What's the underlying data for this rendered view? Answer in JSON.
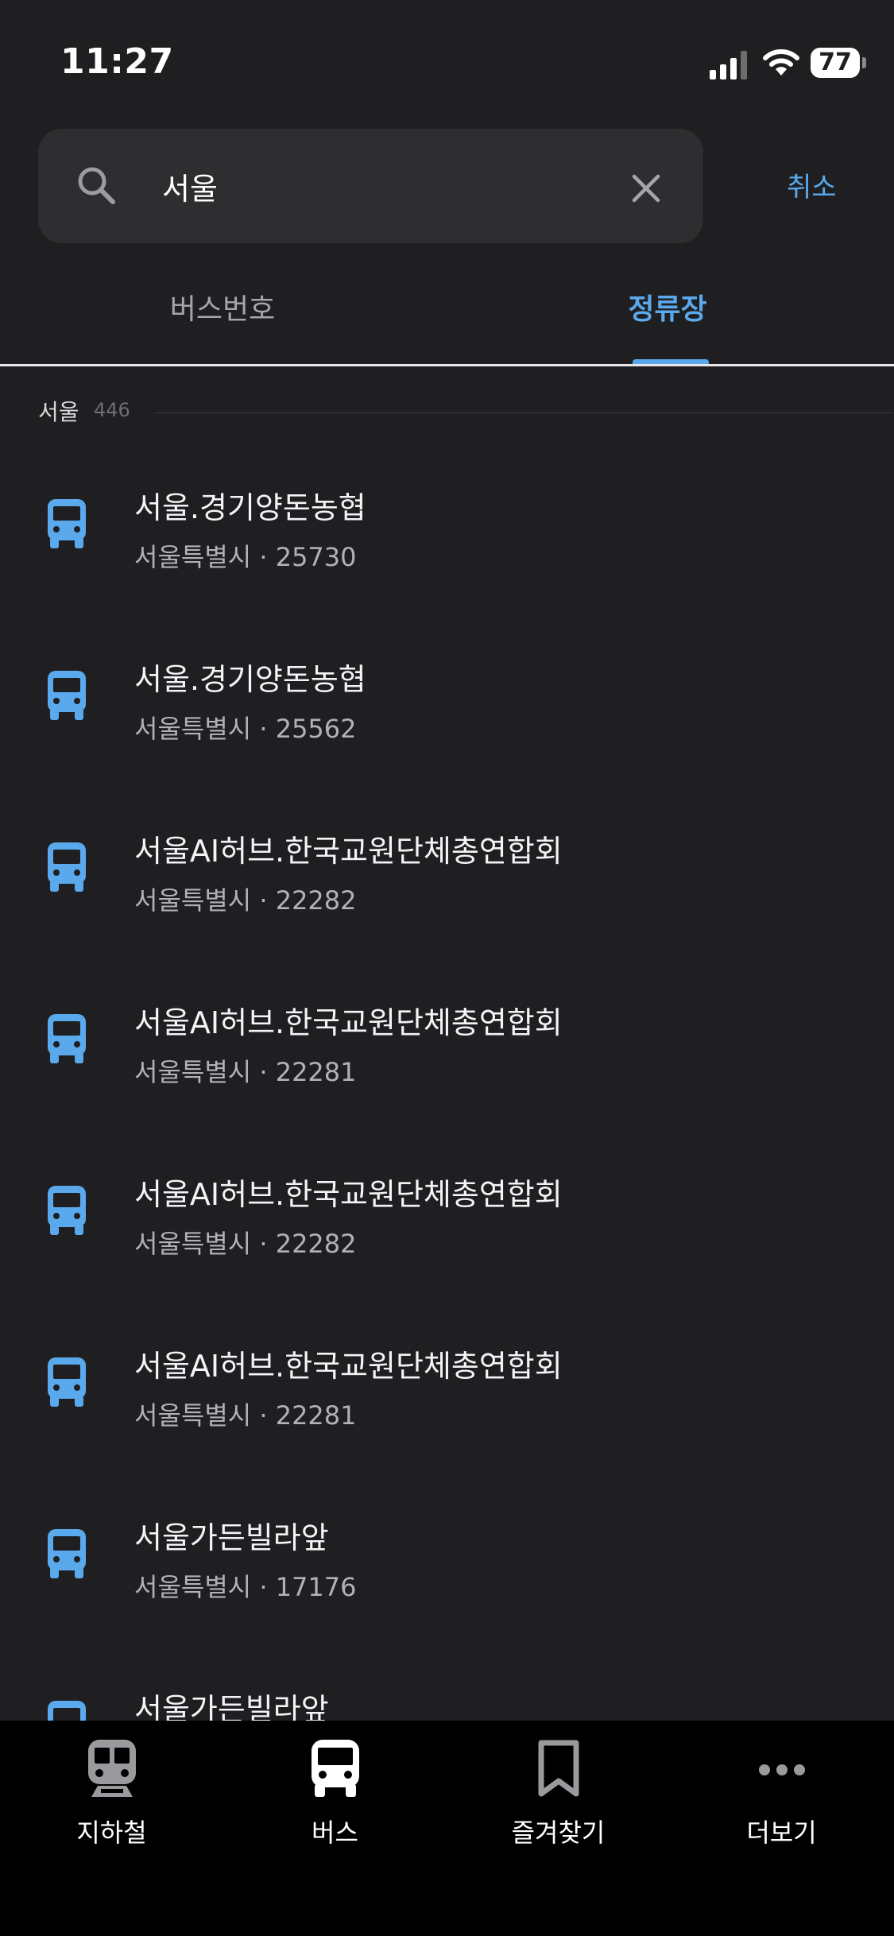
{
  "status_bar": {
    "time": "11:27",
    "battery_level": "77"
  },
  "search": {
    "value": "서울",
    "cancel_label": "취소"
  },
  "tabs": [
    {
      "label": "버스번호",
      "active": false
    },
    {
      "label": "정류장",
      "active": true
    }
  ],
  "section": {
    "title": "서울",
    "count": "446"
  },
  "results": [
    {
      "name": "서울.경기양돈농협",
      "sub": "서울특별시 · 25730"
    },
    {
      "name": "서울.경기양돈농협",
      "sub": "서울특별시 · 25562"
    },
    {
      "name": "서울AI허브.한국교원단체총연합회",
      "sub": "서울특별시 · 22282"
    },
    {
      "name": "서울AI허브.한국교원단체총연합회",
      "sub": "서울특별시 · 22281"
    },
    {
      "name": "서울AI허브.한국교원단체총연합회",
      "sub": "서울특별시 · 22282"
    },
    {
      "name": "서울AI허브.한국교원단체총연합회",
      "sub": "서울특별시 · 22281"
    },
    {
      "name": "서울가든빌라앞",
      "sub": "서울특별시 · 17176"
    },
    {
      "name": "서울가든빌라앞",
      "sub": ""
    }
  ],
  "bottom_nav": [
    {
      "label": "지하철",
      "icon": "subway-icon"
    },
    {
      "label": "버스",
      "icon": "bus-icon"
    },
    {
      "label": "즐겨찾기",
      "icon": "bookmark-icon"
    },
    {
      "label": "더보기",
      "icon": "more-icon"
    }
  ],
  "colors": {
    "background": "#1f1f21",
    "accent": "#5aa9ec",
    "search_box": "#2e2e30",
    "nav_background": "#000000"
  }
}
